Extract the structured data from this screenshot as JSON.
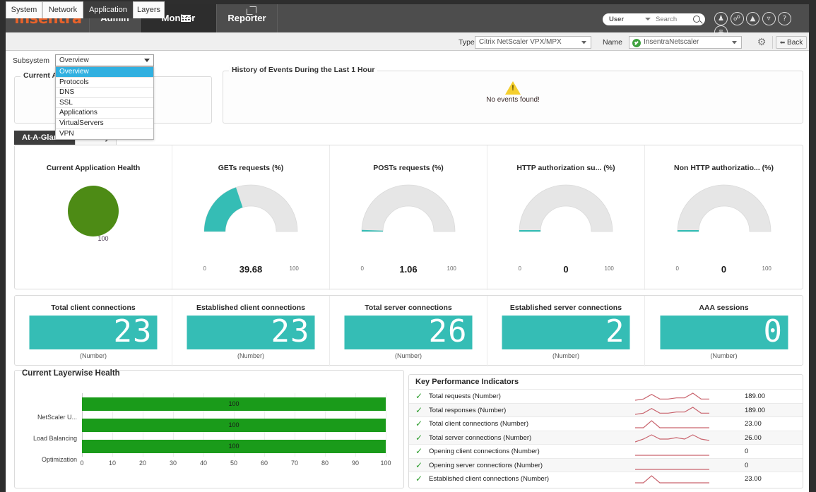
{
  "brand": {
    "logo_text": "insentra",
    "accent": "#e8622a",
    "teal": "#35bdb5",
    "green": "#1a9b1a",
    "health_green": "#4d8b15"
  },
  "topnav": {
    "items": [
      {
        "label": "Admin",
        "name": "nav-admin"
      },
      {
        "label": "Monitor",
        "name": "nav-monitor"
      },
      {
        "label": "Reporter",
        "name": "nav-reporter"
      }
    ],
    "search": {
      "scope": "User",
      "placeholder": "Search",
      "value": ""
    },
    "icons": [
      "user-icon",
      "link-icon",
      "alarm-icon",
      "bell-icon",
      "help-icon",
      "power-icon"
    ]
  },
  "tabstrip": {
    "tabs": [
      {
        "label": "System",
        "active": false
      },
      {
        "label": "Network",
        "active": false
      },
      {
        "label": "Application",
        "active": true
      },
      {
        "label": "Layers",
        "active": false
      }
    ],
    "type_label": "Type",
    "type_value": "Citrix NetScaler VPX/MPX",
    "name_label": "Name",
    "name_value": "InsentraNetscaler",
    "back_label": "Back"
  },
  "subsystem": {
    "label": "Subsystem",
    "value": "Overview",
    "options": [
      "Overview",
      "Protocols",
      "DNS",
      "SSL",
      "Applications",
      "VirtualServers",
      "VPN"
    ],
    "selected_index": 0
  },
  "panels": {
    "left_legend": "Current Ap",
    "right_legend": "History of Events During the Last 1 Hour",
    "no_events": "No events found!"
  },
  "glance_tabs": [
    {
      "label": "At-A-Glance",
      "active": true
    },
    {
      "label": "History",
      "active": false
    }
  ],
  "chart_data": [
    {
      "type": "gauge",
      "title": "Current Application Health",
      "value": 100,
      "value_label": "100",
      "style": "circle",
      "color": "#4d8b15"
    },
    {
      "type": "gauge",
      "title": "GETs requests (%)",
      "value": 39.68,
      "value_label": "39.68",
      "min": 0,
      "max": 100,
      "min_label": "0",
      "max_label": "100",
      "color": "#35bdb5"
    },
    {
      "type": "gauge",
      "title": "POSTs requests (%)",
      "value": 1.06,
      "value_label": "1.06",
      "min": 0,
      "max": 100,
      "min_label": "0",
      "max_label": "100",
      "color": "#35bdb5"
    },
    {
      "type": "gauge",
      "title": "HTTP authorization su... (%)",
      "value": 0,
      "value_label": "0",
      "min": 0,
      "max": 100,
      "min_label": "0",
      "max_label": "100",
      "color": "#35bdb5"
    },
    {
      "type": "gauge",
      "title": "Non HTTP authorizatio... (%)",
      "value": 0,
      "value_label": "0",
      "min": 0,
      "max": 100,
      "min_label": "0",
      "max_label": "100",
      "color": "#35bdb5"
    },
    {
      "type": "bar",
      "title": "Current Layerwise Health",
      "orientation": "horizontal",
      "categories": [
        "NetScaler U...",
        "Load Balancing",
        "Optimization"
      ],
      "values": [
        100,
        100,
        100
      ],
      "data_labels": [
        "100",
        "100",
        "100"
      ],
      "xlabel": "",
      "ylabel": "",
      "xlim": [
        0,
        100
      ],
      "xticks": [
        0,
        10,
        20,
        30,
        40,
        50,
        60,
        70,
        80,
        90,
        100
      ],
      "grid": true,
      "color": "#1a9b1a"
    },
    {
      "type": "table",
      "title": "Key Performance Indicators",
      "columns": [
        "status",
        "indicator",
        "trend",
        "value"
      ],
      "rows": [
        {
          "indicator": "Total requests (Number)",
          "value": "189.00",
          "status": "ok",
          "spark": [
            2,
            3,
            7,
            3,
            3,
            4,
            4,
            8,
            3,
            3
          ]
        },
        {
          "indicator": "Total responses (Number)",
          "value": "189.00",
          "status": "ok",
          "spark": [
            2,
            3,
            7,
            3,
            3,
            4,
            4,
            8,
            3,
            3
          ]
        },
        {
          "indicator": "Total client connections (Number)",
          "value": "23.00",
          "status": "ok",
          "spark": [
            2,
            2,
            7,
            2,
            2,
            2,
            2,
            2,
            2,
            2
          ]
        },
        {
          "indicator": "Total server connections (Number)",
          "value": "26.00",
          "status": "ok",
          "spark": [
            2,
            4,
            7,
            4,
            4,
            5,
            4,
            7,
            4,
            3
          ]
        },
        {
          "indicator": "Opening client connections (Number)",
          "value": "0",
          "status": "ok",
          "spark": [
            2,
            2,
            2,
            2,
            2,
            2,
            2,
            2,
            2,
            2
          ]
        },
        {
          "indicator": "Opening server connections (Number)",
          "value": "0",
          "status": "ok",
          "spark": [
            2,
            2,
            2,
            2,
            2,
            2,
            2,
            2,
            2,
            2
          ]
        },
        {
          "indicator": "Established client connections (Number)",
          "value": "23.00",
          "status": "ok",
          "spark": [
            2,
            2,
            7,
            2,
            2,
            2,
            2,
            2,
            2,
            2
          ]
        }
      ]
    }
  ],
  "lcd_panels": [
    {
      "title": "Total client connections",
      "value": "23",
      "sub": "(Number)"
    },
    {
      "title": "Established client connections",
      "value": "23",
      "sub": "(Number)"
    },
    {
      "title": "Total server connections",
      "value": "26",
      "sub": "(Number)"
    },
    {
      "title": "Established server connections",
      "value": "2",
      "sub": "(Number)"
    },
    {
      "title": "AAA sessions",
      "value": "0",
      "sub": "(Number)"
    }
  ]
}
